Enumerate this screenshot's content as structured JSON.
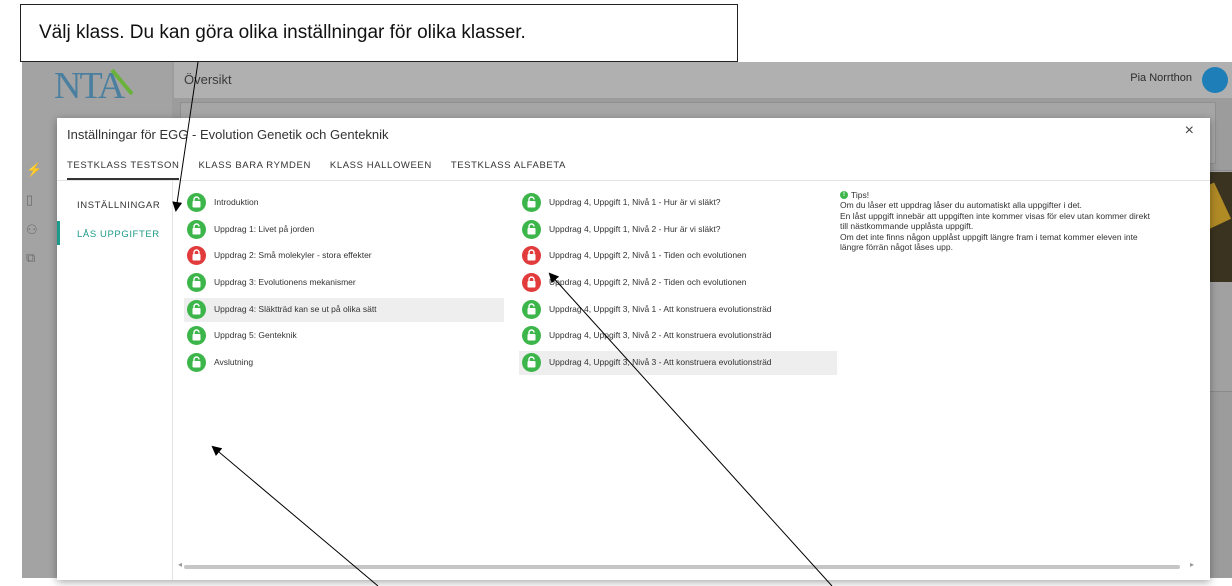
{
  "callout": {
    "text": "Välj klass. Du kan göra olika inställningar för olika klasser."
  },
  "background_app": {
    "header_title": "Översikt",
    "user_name": "Pia Norrthon",
    "logo_text": "NTA"
  },
  "modal": {
    "title": "Inställningar för EGG - Evolution Genetik och Genteknik",
    "close_symbol": "×",
    "tabs": [
      {
        "label": "TESTKLASS TESTSON",
        "active": true
      },
      {
        "label": "KLASS BARA RYMDEN",
        "active": false
      },
      {
        "label": "KLASS HALLOWEEN",
        "active": false
      },
      {
        "label": "TESTKLASS ALFABETA",
        "active": false
      }
    ],
    "side_menu": [
      {
        "label": "INSTÄLLNINGAR",
        "active": false
      },
      {
        "label": "LÅS UPPGIFTER",
        "active": true
      }
    ],
    "left_tasks": [
      {
        "label": "Introduktion",
        "locked": false
      },
      {
        "label": "Uppdrag 1: Livet på jorden",
        "locked": false
      },
      {
        "label": "Uppdrag 2: Små molekyler - stora effekter",
        "locked": true
      },
      {
        "label": "Uppdrag 3: Evolutionens mekanismer",
        "locked": false
      },
      {
        "label": "Uppdrag 4: Släktträd kan se ut på olika sätt",
        "locked": false,
        "highlighted": true
      },
      {
        "label": "Uppdrag 5: Genteknik",
        "locked": false
      },
      {
        "label": "Avslutning",
        "locked": false
      }
    ],
    "right_tasks": [
      {
        "label": "Uppdrag 4, Uppgift 1, Nivå 1 - Hur är vi släkt?",
        "locked": false
      },
      {
        "label": "Uppdrag 4, Uppgift 1, Nivå 2 - Hur är vi släkt?",
        "locked": false
      },
      {
        "label": "Uppdrag 4, Uppgift 2, Nivå 1 - Tiden och evolutionen",
        "locked": true
      },
      {
        "label": "Uppdrag 4, Uppgift 2, Nivå 2 - Tiden och evolutionen",
        "locked": true
      },
      {
        "label": "Uppdrag 4, Uppgift 3, Nivå 1 - Att konstruera evolutionsträd",
        "locked": false
      },
      {
        "label": "Uppdrag 4, Uppgift 3, Nivå 2 - Att konstruera evolutionsträd",
        "locked": false
      },
      {
        "label": "Uppdrag 4, Uppgift 3, Nivå 3 - Att konstruera evolutionsträd",
        "locked": false,
        "highlighted": true
      }
    ],
    "tips": {
      "heading": "Tips!",
      "lines": [
        "Om du låser ett uppdrag låser du automatiskt alla uppgifter i det.",
        "En låst uppgift innebär att uppgiften inte kommer visas för elev utan kommer direkt till nästkommande upplåsta uppgift.",
        "Om det inte finns någon upplåst uppgift längre fram i temat kommer eleven inte längre förrän något låses upp."
      ]
    }
  },
  "colors": {
    "unlocked": "#3cb64a",
    "locked": "#e23b3b",
    "accent": "#1d9a8a"
  }
}
